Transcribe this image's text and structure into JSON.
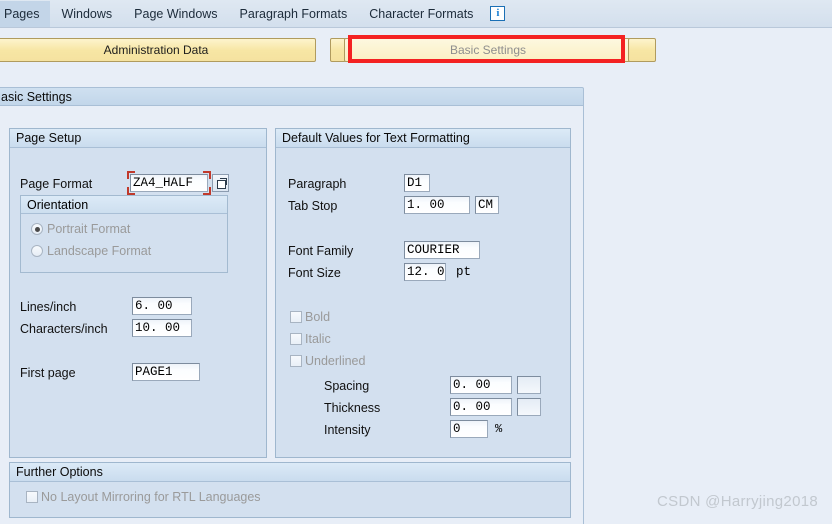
{
  "menu": {
    "items": [
      {
        "label": "Pages"
      },
      {
        "label": "Windows"
      },
      {
        "label": "Page Windows"
      },
      {
        "label": "Paragraph Formats"
      },
      {
        "label": "Character Formats"
      }
    ],
    "info_icon_glyph": "i",
    "info_icon_name": "info-icon"
  },
  "tabs": {
    "admin": {
      "label": "Administration Data",
      "active": true
    },
    "basic": {
      "label": "Basic Settings",
      "active": false,
      "highlighted": true
    }
  },
  "section": {
    "title": "asic Settings"
  },
  "page_setup": {
    "title": "Page Setup",
    "page_format": {
      "label": "Page Format",
      "value": "ZA4_HALF"
    },
    "orientation": {
      "title": "Orientation",
      "portrait": {
        "label": "Portrait Format",
        "selected": true
      },
      "landscape": {
        "label": "Landscape Format",
        "selected": false
      }
    },
    "lines_per_inch": {
      "label": "Lines/inch",
      "value": "6. 00"
    },
    "chars_per_inch": {
      "label": "Characters/inch",
      "value": "10. 00"
    },
    "first_page": {
      "label": "First page",
      "value": "PAGE1"
    }
  },
  "defaults": {
    "title": "Default Values for Text Formatting",
    "paragraph": {
      "label": "Paragraph",
      "value": "D1"
    },
    "tab_stop": {
      "label": "Tab Stop",
      "value": "1. 00",
      "unit": "CM"
    },
    "font_family": {
      "label": "Font Family",
      "value": "COURIER"
    },
    "font_size": {
      "label": "Font Size",
      "value": "12. 0",
      "unit": "pt"
    },
    "bold": {
      "label": "Bold",
      "checked": false
    },
    "italic": {
      "label": "Italic",
      "checked": false
    },
    "underlined": {
      "label": "Underlined",
      "checked": false
    },
    "spacing": {
      "label": "Spacing",
      "value": "0. 00",
      "unit": ""
    },
    "thickness": {
      "label": "Thickness",
      "value": "0. 00",
      "unit": ""
    },
    "intensity": {
      "label": "Intensity",
      "value": "0",
      "unit": "%"
    }
  },
  "further_options": {
    "title": "Further Options",
    "no_mirroring": {
      "label": "No Layout Mirroring for RTL Languages",
      "checked": false
    }
  },
  "watermark": {
    "text": "CSDN @Harryjing2018"
  },
  "colors": {
    "background": "#e8eef7",
    "panel": "#d3e0ef",
    "tab_active": "#f7e6a4",
    "highlight": "#f42222",
    "required": "#c0392b",
    "info": "#1a7fd4"
  }
}
